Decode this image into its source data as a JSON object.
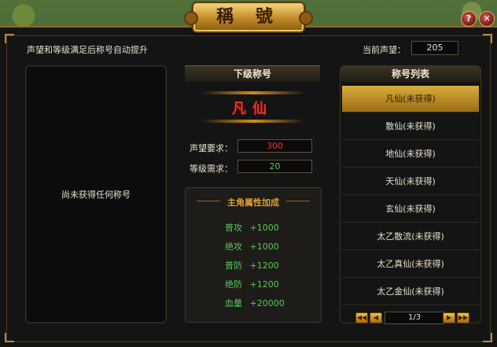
{
  "window": {
    "title": "稱 號"
  },
  "controls": {
    "help": "?",
    "close": "✕"
  },
  "hint": "声望和等级满足后称号自动提升",
  "reputation": {
    "label": "当前声望：",
    "value": "205"
  },
  "left_panel": {
    "empty_text": "尚未获得任何称号"
  },
  "next_title": {
    "header": "下级称号",
    "name": "凡仙",
    "req_rep_label": "声望要求：",
    "req_rep_value": "300",
    "req_lvl_label": "等级需求：",
    "req_lvl_value": "20"
  },
  "attributes": {
    "title": "主角属性加成",
    "rows": [
      {
        "name": "普攻",
        "value": "+1000"
      },
      {
        "name": "绝攻",
        "value": "+1000"
      },
      {
        "name": "普防",
        "value": "+1200"
      },
      {
        "name": "绝防",
        "value": "+1200"
      },
      {
        "name": "血量",
        "value": "+20000"
      }
    ]
  },
  "title_list": {
    "header": "称号列表",
    "items": [
      "凡仙(未获得)",
      "散仙(未获得)",
      "地仙(未获得)",
      "天仙(未获得)",
      "玄仙(未获得)",
      "太乙散流(未获得)",
      "太乙真仙(未获得)",
      "太乙金仙(未获得)"
    ],
    "selected_index": 0
  },
  "pager": {
    "page_text": "1/3"
  },
  "colors": {
    "accent_gold": "#d9ad3c",
    "requirement_red": "#e0382a",
    "bonus_green": "#55c85a"
  }
}
